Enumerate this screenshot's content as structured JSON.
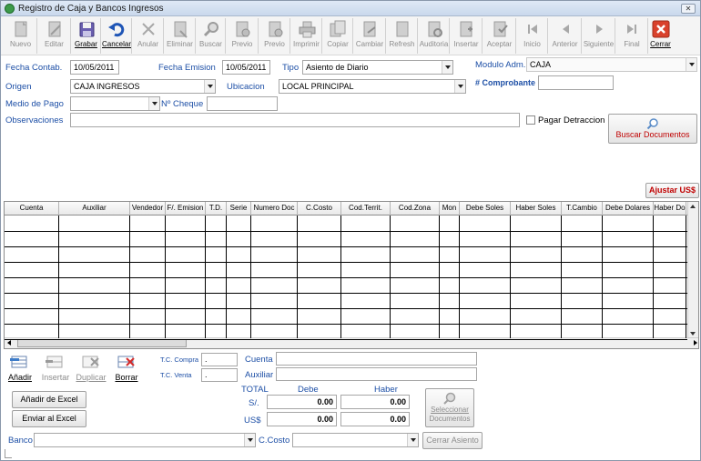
{
  "window": {
    "title": "Registro de Caja y Bancos Ingresos",
    "close_glyph": "✕"
  },
  "toolbar": [
    {
      "label": "Nuevo",
      "icon": "new-document-icon",
      "state": "disabled"
    },
    {
      "label": "Editar",
      "icon": "edit-document-icon",
      "state": "disabled"
    },
    {
      "label": "Grabar",
      "icon": "save-disk-icon",
      "state": "enabled"
    },
    {
      "label": "Cancelar",
      "icon": "undo-arrow-icon",
      "state": "enabled"
    },
    {
      "label": "Anular",
      "icon": "x-cross-icon",
      "state": "disabled"
    },
    {
      "label": "Eliminar",
      "icon": "delete-document-icon",
      "state": "disabled"
    },
    {
      "label": "Buscar",
      "icon": "search-magnifier-icon",
      "state": "disabled"
    },
    {
      "label": "Previo",
      "icon": "preview-document-icon",
      "state": "disabled"
    },
    {
      "label": "Previo",
      "icon": "preview-document-icon",
      "state": "disabled"
    },
    {
      "label": "Imprimir",
      "icon": "printer-icon",
      "state": "disabled"
    },
    {
      "label": "Copiar",
      "icon": "copy-document-icon",
      "state": "disabled"
    },
    {
      "label": "Cambiar",
      "icon": "change-document-icon",
      "state": "disabled"
    },
    {
      "label": "Refresh",
      "icon": "refresh-document-icon",
      "state": "disabled"
    },
    {
      "label": "Auditoria",
      "icon": "audit-document-icon",
      "state": "disabled"
    },
    {
      "label": "Insertar",
      "icon": "insert-document-icon",
      "state": "disabled"
    },
    {
      "label": "Aceptar",
      "icon": "accept-document-icon",
      "state": "disabled"
    },
    {
      "label": "Inicio",
      "icon": "first-record-icon",
      "state": "disabled"
    },
    {
      "label": "Anterior",
      "icon": "previous-record-icon",
      "state": "disabled"
    },
    {
      "label": "Siguiente",
      "icon": "next-record-icon",
      "state": "disabled"
    },
    {
      "label": "Final",
      "icon": "last-record-icon",
      "state": "disabled"
    },
    {
      "label": "Cerrar",
      "icon": "close-red-icon",
      "state": "enabled"
    }
  ],
  "form": {
    "fecha_contab_label": "Fecha Contab.",
    "fecha_contab": "10/05/2011",
    "fecha_emision_label": "Fecha Emision",
    "fecha_emision": "10/05/2011",
    "tipo_label": "Tipo",
    "tipo": "Asiento de Diario",
    "modulo_label": "Modulo Adm.",
    "modulo": "CAJA",
    "origen_label": "Origen",
    "origen": "CAJA INGRESOS",
    "ubicacion_label": "Ubicacion",
    "ubicacion": "LOCAL PRINCIPAL",
    "comprobante_label": "# Comprobante",
    "comprobante": "",
    "medio_pago_label": "Medio de Pago",
    "medio_pago": "",
    "cheque_label": "Nº Cheque",
    "cheque": "",
    "observaciones_label": "Observaciones",
    "observaciones": "",
    "detraccion_label": "Pagar Detraccion",
    "buscar_documentos": "Buscar Documentos",
    "ajustar": "Ajustar US$"
  },
  "grid": {
    "columns": [
      "Cuenta",
      "Auxiliar",
      "Vendedor",
      "F/. Emision",
      "T.D.",
      "Serie",
      "Numero Doc",
      "C.Costo",
      "Cod.Territ.",
      "Cod.Zona",
      "Mon",
      "Debe Soles",
      "Haber Soles",
      "T.Cambio",
      "Debe Dolares",
      "Haber Do"
    ]
  },
  "bottom": {
    "anadir": "Añadir",
    "insertar": "Insertar",
    "duplicar": "Duplicar",
    "borrar": "Borrar",
    "tc_compra_label": "T.C. Compra",
    "tc_compra": ".",
    "tc_venta_label": "T.C. Venta",
    "tc_venta": ".",
    "cuenta_label": "Cuenta",
    "cuenta": "",
    "auxiliar_label": "Auxiliar",
    "auxiliar": "",
    "total_label": "TOTAL",
    "debe_label": "Debe",
    "haber_label": "Haber",
    "soles_label": "S/.",
    "soles_debe": "0.00",
    "soles_haber": "0.00",
    "dolares_label": "US$",
    "dolares_debe": "0.00",
    "dolares_haber": "0.00",
    "anadir_excel": "Añadir de Excel",
    "enviar_excel": "Enviar al Excel",
    "seleccionar_l1": "Seleccionar",
    "seleccionar_l2": "Documentos",
    "banco_label": "Banco",
    "banco": "",
    "ccosto_label": "C.Costo",
    "ccosto": "",
    "cerrar_asiento": "Cerrar Asiento"
  }
}
